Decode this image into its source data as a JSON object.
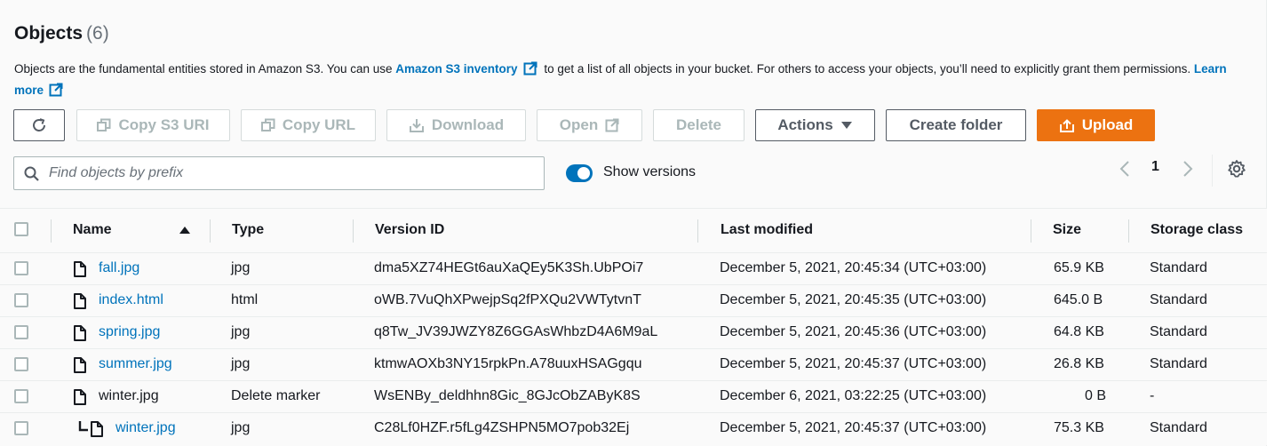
{
  "header": {
    "title": "Objects",
    "count": "(6)"
  },
  "description": {
    "text1": "Objects are the fundamental entities stored in Amazon S3. You can use ",
    "link1": "Amazon S3 inventory",
    "text2": " to get a list of all objects in your bucket. For others to access your objects, you’ll need to explicitly grant them permissions. ",
    "link2": "Learn more"
  },
  "toolbar": {
    "refresh_icon": "refresh-icon",
    "copy_s3_uri": "Copy S3 URI",
    "copy_url": "Copy URL",
    "download": "Download",
    "open": "Open",
    "delete": "Delete",
    "actions": "Actions",
    "create_folder": "Create folder",
    "upload": "Upload",
    "upload_color": "#ec7211"
  },
  "search": {
    "placeholder": "Find objects by prefix"
  },
  "versions_toggle": {
    "label": "Show versions",
    "on": true
  },
  "pagination": {
    "current_page": "1"
  },
  "table": {
    "columns": [
      "Name",
      "Type",
      "Version ID",
      "Last modified",
      "Size",
      "Storage class"
    ],
    "rows": [
      {
        "name": "fall.jpg",
        "type": "jpg",
        "version": "dma5XZ74HEGt6auXaQEy5K3Sh.UbPOi7",
        "modified": "December 5, 2021, 20:45:34 (UTC+03:00)",
        "size": "65.9 KB",
        "storage": "Standard"
      },
      {
        "name": "index.html",
        "type": "html",
        "version": "oWB.7VuQhXPwejpSq2fPXQu2VWTytvnT",
        "modified": "December 5, 2021, 20:45:35 (UTC+03:00)",
        "size": "645.0 B",
        "storage": "Standard"
      },
      {
        "name": "spring.jpg",
        "type": "jpg",
        "version": "q8Tw_JV39JWZY8Z6GGAsWhbzD4A6M9aL",
        "modified": "December 5, 2021, 20:45:36 (UTC+03:00)",
        "size": "64.8 KB",
        "storage": "Standard"
      },
      {
        "name": "summer.jpg",
        "type": "jpg",
        "version": "ktmwAOXb3NY15rpkPn.A78uuxHSAGgqu",
        "modified": "December 5, 2021, 20:45:37 (UTC+03:00)",
        "size": "26.8 KB",
        "storage": "Standard"
      },
      {
        "name": "winter.jpg",
        "type": "Delete marker",
        "version": "WsENBy_deldhhn8Gic_8GJcObZAByK8S",
        "modified": "December 6, 2021, 03:22:25 (UTC+03:00)",
        "size": "0 B",
        "storage": "-"
      },
      {
        "name": "winter.jpg",
        "type": "jpg",
        "version": "C28Lf0HZF.r5fLg4ZSHPN5MO7pob32Ej",
        "modified": "December 5, 2021, 20:45:37 (UTC+03:00)",
        "size": "75.3 KB",
        "storage": "Standard"
      }
    ]
  },
  "colors": {
    "link": "#0073bb",
    "accent": "#ec7211"
  }
}
